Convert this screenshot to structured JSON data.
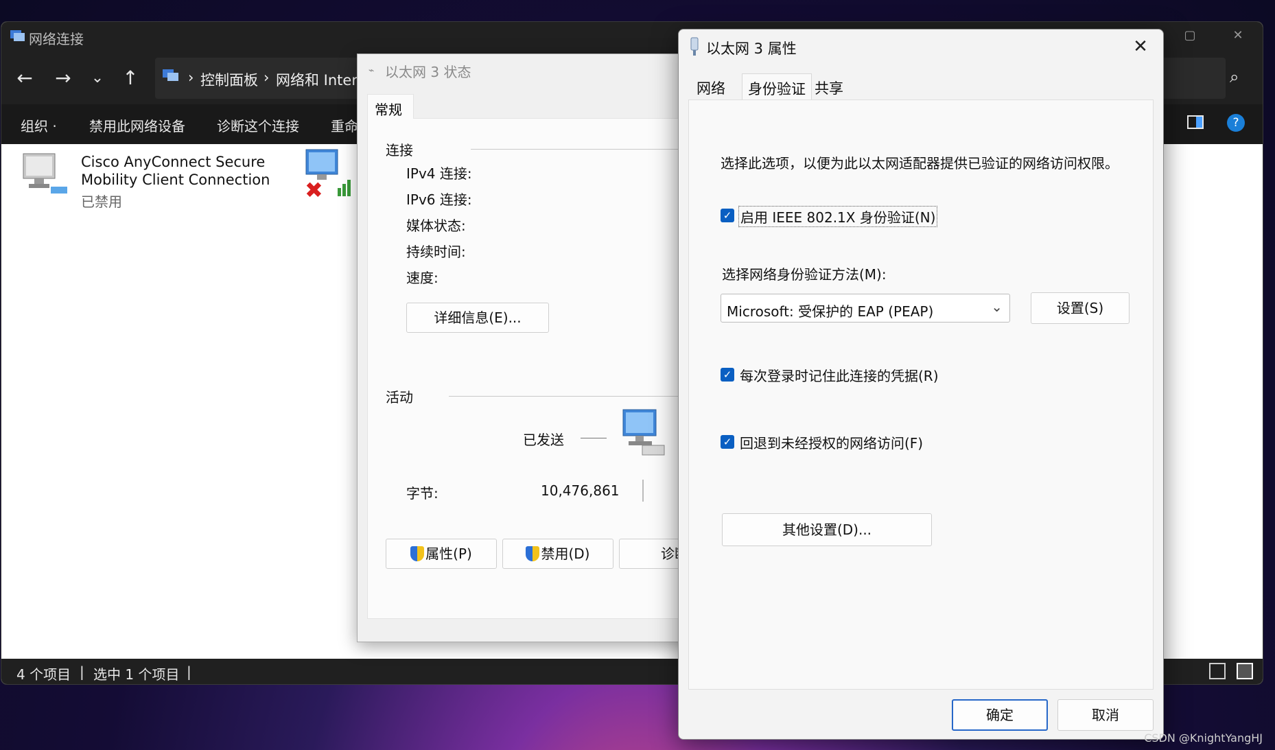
{
  "explorer": {
    "title": "网络连接",
    "breadcrumb": [
      "控制面板",
      "网络和 Intern"
    ],
    "commands": [
      "组织 ·",
      "禁用此网络设备",
      "诊断这个连接",
      "重命"
    ],
    "items": [
      {
        "name_line1": "Cisco AnyConnect Secure",
        "name_line2": "Mobility Client Connection",
        "status": "已禁用"
      }
    ],
    "statusbar": {
      "count": "4 个项目",
      "selected": "选中 1 个项目"
    }
  },
  "status_dialog": {
    "title": "以太网 3 状态",
    "tab": "常规",
    "connection_section": "连接",
    "fields": [
      "IPv4 连接:",
      "IPv6 连接:",
      "媒体状态:",
      "持续时间:",
      "速度:"
    ],
    "details_button": "详细信息(E)...",
    "activity_section": "活动",
    "sent_label": "已发送",
    "bytes_label": "字节:",
    "bytes_sent": "10,476,861",
    "buttons": {
      "properties": "属性(P)",
      "disable": "禁用(D)",
      "diagnose": "诊断"
    }
  },
  "properties_dialog": {
    "title": "以太网 3 属性",
    "tabs": [
      "网络",
      "身份验证",
      "共享"
    ],
    "active_tab": "身份验证",
    "description": "选择此选项，以便为此以太网适配器提供已验证的网络访问权限。",
    "enable_8021x": {
      "label": "启用 IEEE 802.1X 身份验证(N)",
      "checked": true
    },
    "method_label": "选择网络身份验证方法(M):",
    "method_value": "Microsoft: 受保护的 EAP (PEAP)",
    "settings_button": "设置(S)",
    "remember_creds": {
      "label": "每次登录时记住此连接的凭据(R)",
      "checked": true
    },
    "fallback": {
      "label": "回退到未经授权的网络访问(F)",
      "checked": true
    },
    "additional_button": "其他设置(D)...",
    "ok_button": "确定",
    "cancel_button": "取消"
  },
  "watermark": "CSDN @KnightYangHJ",
  "colors": {
    "accent": "#0a5fc2",
    "titlebar_dark": "#202020"
  }
}
